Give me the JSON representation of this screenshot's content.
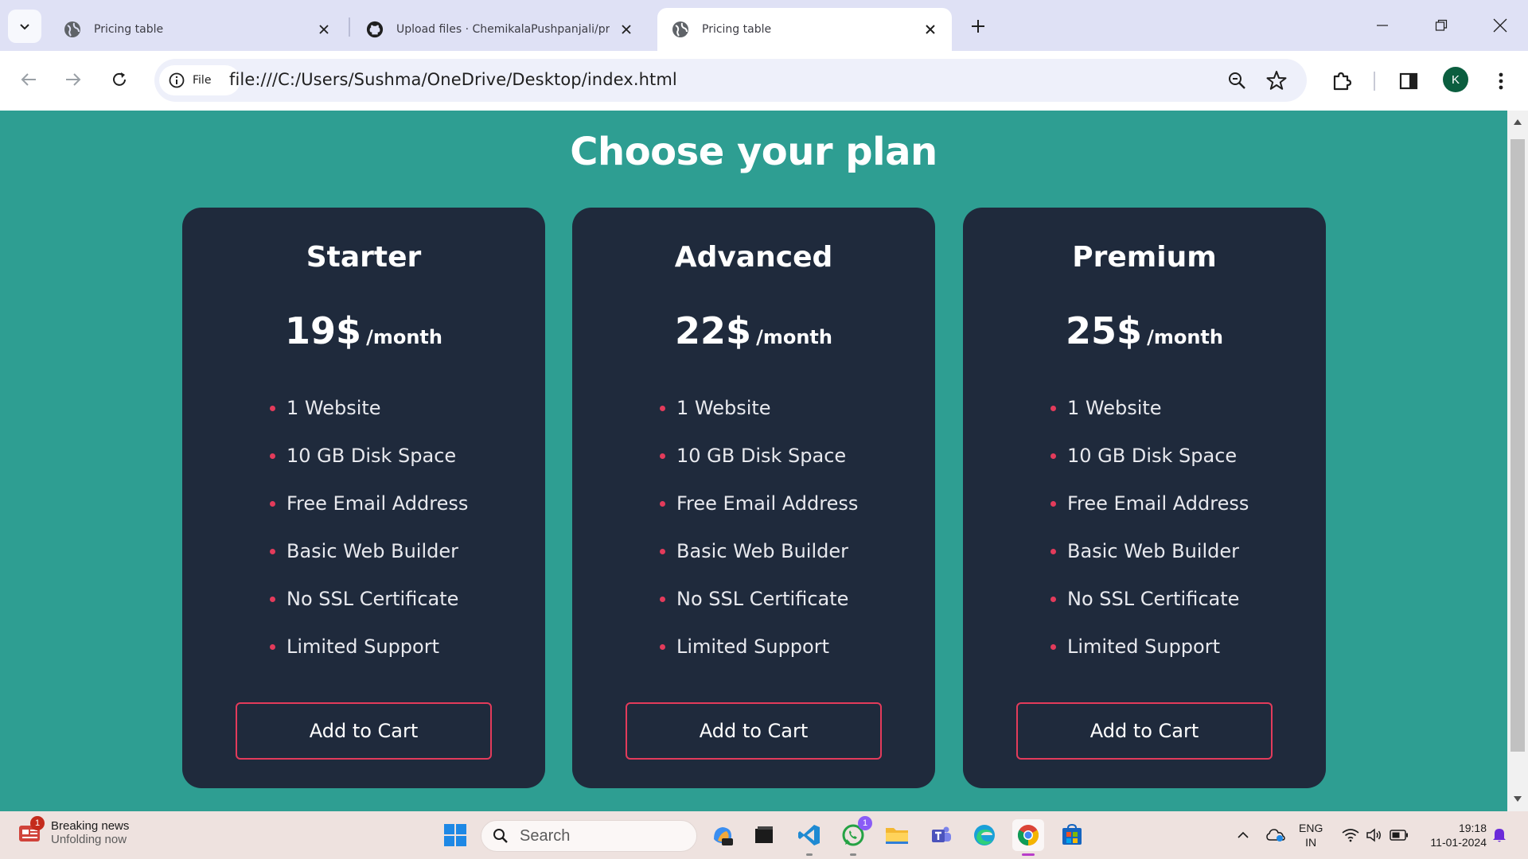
{
  "browser": {
    "tabs": [
      {
        "title": "Pricing table",
        "active": false
      },
      {
        "title": "Upload files · ChemikalaPushpanjali/pricin",
        "active": false
      },
      {
        "title": "Pricing table",
        "active": true
      }
    ],
    "site_chip_label": "File",
    "url": "file:///C:/Users/Sushma/OneDrive/Desktop/index.html",
    "profile_initial": "K"
  },
  "page": {
    "title": "Choose your plan",
    "plans": [
      {
        "name": "Starter",
        "price": "19$",
        "period": "/month",
        "features": [
          "1 Website",
          "10 GB Disk Space",
          "Free Email Address",
          "Basic Web Builder",
          "No SSL Certificate",
          "Limited Support"
        ],
        "button": "Add to Cart"
      },
      {
        "name": "Advanced",
        "price": "22$",
        "period": "/month",
        "features": [
          "1 Website",
          "10 GB Disk Space",
          "Free Email Address",
          "Basic Web Builder",
          "No SSL Certificate",
          "Limited Support"
        ],
        "button": "Add to Cart"
      },
      {
        "name": "Premium",
        "price": "25$",
        "period": "/month",
        "features": [
          "1 Website",
          "10 GB Disk Space",
          "Free Email Address",
          "Basic Web Builder",
          "No SSL Certificate",
          "Limited Support"
        ],
        "button": "Add to Cart"
      }
    ]
  },
  "taskbar": {
    "news_title": "Breaking news",
    "news_subtitle": "Unfolding now",
    "news_badge": "1",
    "search_label": "Search",
    "whatsapp_badge": "1",
    "language": "ENG",
    "region": "IN",
    "time": "19:18",
    "date": "11-01-2024"
  },
  "colors": {
    "page_background": "#2e9e92",
    "card_background": "#1f2a3c",
    "accent": "#e33b5b",
    "tabbar": "#dfe1f5",
    "taskbar": "#eee2df"
  }
}
